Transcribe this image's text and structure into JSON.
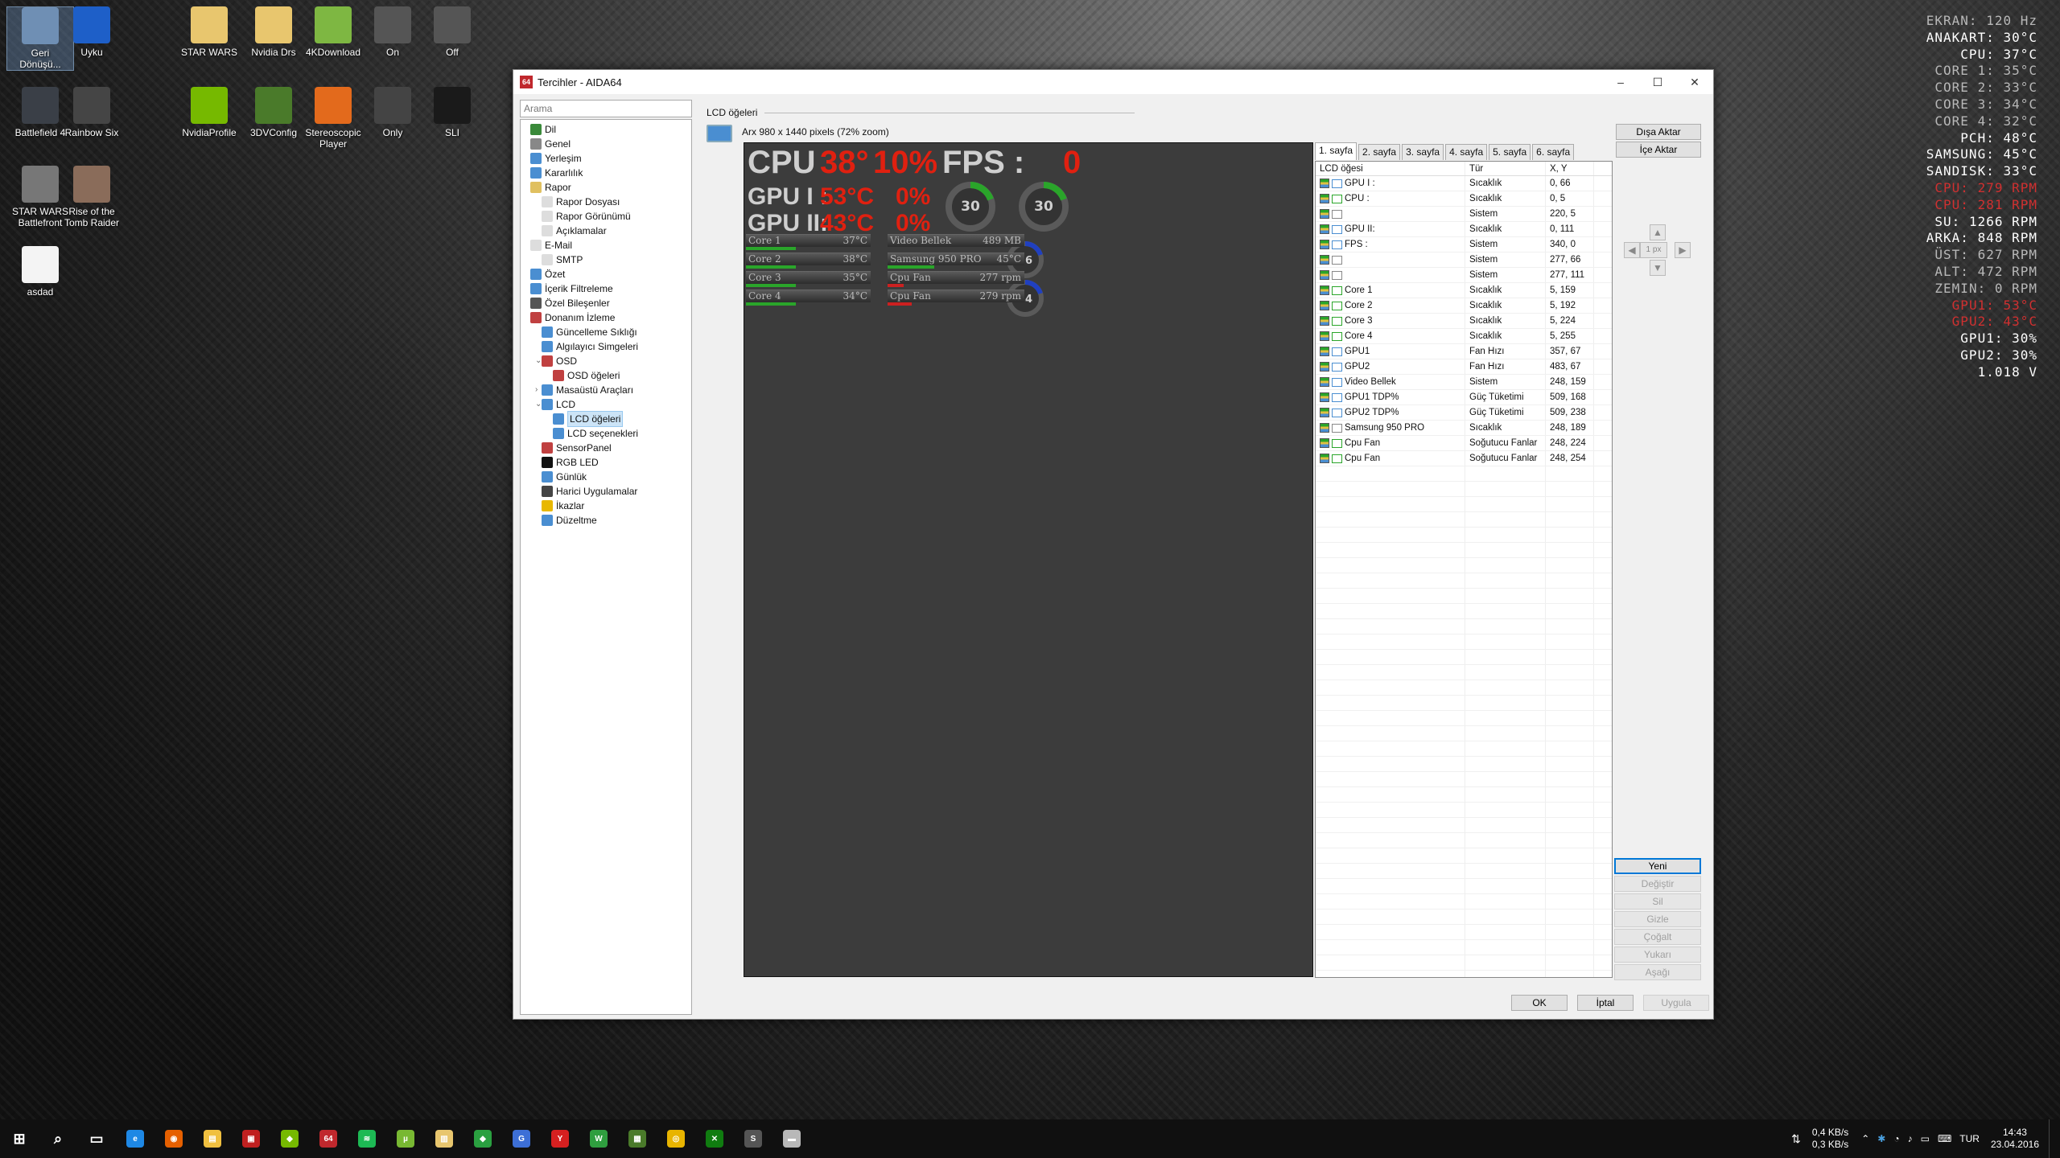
{
  "desktop": {
    "icons": [
      {
        "label": "Geri\nDönüşü...",
        "name": "recycle-bin-icon",
        "color": "#6f8fb4"
      },
      {
        "label": "Uyku",
        "name": "windows-sleep-icon",
        "color": "#1e5fc8"
      },
      {
        "label": "STAR WARS",
        "name": "folder-icon",
        "color": "#e8c66e"
      },
      {
        "label": "Nvidia Drs",
        "name": "folder-icon",
        "color": "#e8c66e"
      },
      {
        "label": "4KDownload",
        "name": "download-icon",
        "color": "#7eb742"
      },
      {
        "label": "On",
        "name": "3d-glasses-icon",
        "color": "#555"
      },
      {
        "label": "Off",
        "name": "3d-glasses-icon",
        "color": "#555"
      },
      {
        "label": "Battlefield 4",
        "name": "game-icon",
        "color": "#3a3f47"
      },
      {
        "label": "Rainbow Six",
        "name": "game-icon",
        "color": "#454545"
      },
      {
        "label": "NvidiaProfile",
        "name": "nvidia-icon",
        "color": "#76b900"
      },
      {
        "label": "3DVConfig",
        "name": "3dv-config-icon",
        "color": "#4a7a2a"
      },
      {
        "label": "Stereoscopic\nPlayer",
        "name": "stereo-player-icon",
        "color": "#e36a1c"
      },
      {
        "label": "Only",
        "name": "sli-icon",
        "color": "#444"
      },
      {
        "label": "SLI",
        "name": "3d-nvidia-icon",
        "color": "#1a1a1a"
      },
      {
        "label": "STAR WARS\nBattlefront",
        "name": "game-icon",
        "color": "#777"
      },
      {
        "label": "Rise of the\nTomb Raider",
        "name": "game-icon",
        "color": "#8a6c5a"
      },
      {
        "label": "asdad",
        "name": "file-icon",
        "color": "#f4f4f4"
      }
    ]
  },
  "osd": [
    {
      "text": "EKRAN: 120 Hz",
      "color": "#b8b8b8"
    },
    {
      "text": "ANAKART: 30°C",
      "color": "#ffffff"
    },
    {
      "text": "CPU: 37°C",
      "color": "#ffffff"
    },
    {
      "text": "CORE 1: 35°C",
      "color": "#b8b8b8"
    },
    {
      "text": "CORE 2: 33°C",
      "color": "#b8b8b8"
    },
    {
      "text": "CORE 3: 34°C",
      "color": "#b8b8b8"
    },
    {
      "text": "CORE 4: 32°C",
      "color": "#b8b8b8"
    },
    {
      "text": "PCH: 48°C",
      "color": "#ffffff"
    },
    {
      "text": "SAMSUNG: 45°C",
      "color": "#ffffff"
    },
    {
      "text": "SANDISK: 33°C",
      "color": "#ffffff"
    },
    {
      "text": "CPU: 279 RPM",
      "color": "#d03030"
    },
    {
      "text": "CPU: 281 RPM",
      "color": "#d03030"
    },
    {
      "text": "SU: 1266 RPM",
      "color": "#ffffff"
    },
    {
      "text": "ARKA: 848 RPM",
      "color": "#ffffff"
    },
    {
      "text": "ÜST: 627 RPM",
      "color": "#b8b8b8"
    },
    {
      "text": "ALT: 472 RPM",
      "color": "#b8b8b8"
    },
    {
      "text": "ZEMIN: 0 RPM",
      "color": "#b8b8b8"
    },
    {
      "text": "GPU1: 53°C",
      "color": "#d03030"
    },
    {
      "text": "GPU2: 43°C",
      "color": "#d03030"
    },
    {
      "text": "GPU1: 30%",
      "color": "#ffffff"
    },
    {
      "text": "GPU2: 30%",
      "color": "#ffffff"
    },
    {
      "text": "1.018 V",
      "color": "#ffffff"
    }
  ],
  "window": {
    "title": "Tercihler - AIDA64",
    "app_badge": "64",
    "buttons": {
      "minimize": "–",
      "maximize": "☐",
      "close": "✕"
    }
  },
  "search": {
    "placeholder": "Arama"
  },
  "tree": [
    {
      "label": "Dil",
      "depth": 0,
      "color": "#3a8a3a"
    },
    {
      "label": "Genel",
      "depth": 0,
      "color": "#888"
    },
    {
      "label": "Yerleşim",
      "depth": 0,
      "color": "#4a8ed1"
    },
    {
      "label": "Kararlılık",
      "depth": 0,
      "color": "#4a8ed1"
    },
    {
      "label": "Rapor",
      "depth": 0,
      "color": "#e0c060"
    },
    {
      "label": "Rapor Dosyası",
      "depth": 1,
      "color": "#ddd"
    },
    {
      "label": "Rapor Görünümü",
      "depth": 1,
      "color": "#ddd"
    },
    {
      "label": "Açıklamalar",
      "depth": 1,
      "color": "#ddd"
    },
    {
      "label": "E-Mail",
      "depth": 0,
      "color": "#ddd"
    },
    {
      "label": "SMTP",
      "depth": 1,
      "color": "#ddd"
    },
    {
      "label": "Özet",
      "depth": 0,
      "color": "#4a8ed1"
    },
    {
      "label": "İçerik Filtreleme",
      "depth": 0,
      "color": "#4a8ed1"
    },
    {
      "label": "Özel Bileşenler",
      "depth": 0,
      "color": "#555"
    },
    {
      "label": "Donanım İzleme",
      "depth": 0,
      "color": "#c04040"
    },
    {
      "label": "Güncelleme Sıklığı",
      "depth": 1,
      "color": "#4a8ed1"
    },
    {
      "label": "Algılayıcı Simgeleri",
      "depth": 1,
      "color": "#4a8ed1"
    },
    {
      "label": "OSD",
      "depth": 1,
      "color": "#c04040",
      "expander": "⌄"
    },
    {
      "label": "OSD öğeleri",
      "depth": 2,
      "color": "#c04040"
    },
    {
      "label": "Masaüstü Araçları",
      "depth": 1,
      "color": "#4a8ed1",
      "expander": "›"
    },
    {
      "label": "LCD",
      "depth": 1,
      "color": "#4a8ed1",
      "expander": "⌄"
    },
    {
      "label": "LCD öğeleri",
      "depth": 2,
      "color": "#4a8ed1",
      "selected": true
    },
    {
      "label": "LCD seçenekleri",
      "depth": 2,
      "color": "#4a8ed1"
    },
    {
      "label": "SensorPanel",
      "depth": 1,
      "color": "#c04040"
    },
    {
      "label": "RGB LED",
      "depth": 1,
      "color": "#111"
    },
    {
      "label": "Günlük",
      "depth": 1,
      "color": "#4a8ed1"
    },
    {
      "label": "Harici Uygulamalar",
      "depth": 1,
      "color": "#444"
    },
    {
      "label": "İkazlar",
      "depth": 1,
      "color": "#e8b800"
    },
    {
      "label": "Düzeltme",
      "depth": 1,
      "color": "#4a8ed1"
    }
  ],
  "panel": {
    "header": "LCD öğeleri",
    "resolution": "Arx 980 x 1440 pixels (72% zoom)"
  },
  "lcd": {
    "cpu_label": "CPU",
    "cpu_temp": "38°",
    "cpu_load": "10%",
    "fps_label": "FPS :",
    "fps_value": "0",
    "gpu1_label": "GPU I :",
    "gpu1_temp": "53°C",
    "gpu1_load": "0%",
    "gpu2_label": "GPU II:",
    "gpu2_temp": "43°C",
    "gpu2_load": "0%",
    "gauge_gpu1": "30",
    "gauge_gpu2": "30",
    "gauge_fan1": "26",
    "gauge_fan2": "24",
    "bars_left": [
      {
        "label": "Core 1",
        "value": "37°C"
      },
      {
        "label": "Core 2",
        "value": "38°C"
      },
      {
        "label": "Core 3",
        "value": "35°C"
      },
      {
        "label": "Core 4",
        "value": "34°C"
      }
    ],
    "bars_right": [
      {
        "label": "Video Bellek",
        "value": "489 MB",
        "color": "#2aa52a"
      },
      {
        "label": "Samsung 950 PRO",
        "value": "45°C",
        "color": "#2aa52a"
      },
      {
        "label": "Cpu Fan",
        "value": "277 rpm",
        "color": "#cc2020"
      },
      {
        "label": "Cpu Fan",
        "value": "279 rpm",
        "color": "#cc2020"
      }
    ]
  },
  "tabs": [
    "1. sayfa",
    "2. sayfa",
    "3. sayfa",
    "4. sayfa",
    "5. sayfa",
    "6. sayfa"
  ],
  "list": {
    "headers": [
      "LCD öğesi",
      "Tür",
      "X, Y"
    ],
    "rows": [
      {
        "name": "GPU I :",
        "type": "Sıcaklık",
        "xy": "0, 66",
        "icon": "monitor"
      },
      {
        "name": "CPU :",
        "type": "Sıcaklık",
        "xy": "0, 5",
        "icon": "chip"
      },
      {
        "name": "",
        "type": "Sistem",
        "xy": "220, 5",
        "icon": "hourglass"
      },
      {
        "name": "GPU II:",
        "type": "Sıcaklık",
        "xy": "0, 111",
        "icon": "monitor"
      },
      {
        "name": "FPS :",
        "type": "Sistem",
        "xy": "340, 0",
        "icon": "monitor"
      },
      {
        "name": "",
        "type": "Sistem",
        "xy": "277, 66",
        "icon": "hourglass"
      },
      {
        "name": "",
        "type": "Sistem",
        "xy": "277, 111",
        "icon": "hourglass"
      },
      {
        "name": "Core 1",
        "type": "Sıcaklık",
        "xy": "5, 159",
        "icon": "chip"
      },
      {
        "name": "Core 2",
        "type": "Sıcaklık",
        "xy": "5, 192",
        "icon": "chip"
      },
      {
        "name": "Core 3",
        "type": "Sıcaklık",
        "xy": "5, 224",
        "icon": "chip"
      },
      {
        "name": "Core 4",
        "type": "Sıcaklık",
        "xy": "5, 255",
        "icon": "chip"
      },
      {
        "name": "GPU1",
        "type": "Fan Hızı",
        "xy": "357, 67",
        "icon": "monitor"
      },
      {
        "name": "GPU2",
        "type": "Fan Hızı",
        "xy": "483, 67",
        "icon": "monitor"
      },
      {
        "name": "Video Bellek",
        "type": "Sistem",
        "xy": "248, 159",
        "icon": "memory"
      },
      {
        "name": "GPU1 TDP%",
        "type": "Güç Tüketimi",
        "xy": "509, 168",
        "icon": "monitor"
      },
      {
        "name": "GPU2 TDP%",
        "type": "Güç Tüketimi",
        "xy": "509, 238",
        "icon": "monitor"
      },
      {
        "name": "Samsung 950 PRO",
        "type": "Sıcaklık",
        "xy": "248, 189",
        "icon": "disk"
      },
      {
        "name": "Cpu Fan",
        "type": "Soğutucu Fanlar",
        "xy": "248, 224",
        "icon": "chip"
      },
      {
        "name": "Cpu Fan",
        "type": "Soğutucu Fanlar",
        "xy": "248, 254",
        "icon": "chip"
      }
    ]
  },
  "side": {
    "export": "Dışa Aktar",
    "import": "İçe Aktar",
    "step": "1 px",
    "new": "Yeni",
    "modify": "Değiştir",
    "delete": "Sil",
    "hide": "Gizle",
    "duplicate": "Çoğalt",
    "up": "Yukarı",
    "down": "Aşağı"
  },
  "footer": {
    "ok": "OK",
    "cancel": "İptal",
    "apply": "Uygula"
  },
  "taskbar": {
    "items": [
      {
        "name": "start-icon",
        "color": "#ffffff",
        "glyph": "⊞"
      },
      {
        "name": "search-icon",
        "color": "#ffffff",
        "glyph": "⌕"
      },
      {
        "name": "task-view-icon",
        "color": "#ffffff",
        "glyph": "▭"
      },
      {
        "name": "edge-icon",
        "color": "#1e88e5",
        "glyph": "e"
      },
      {
        "name": "firefox-icon",
        "color": "#e66000",
        "glyph": "◉"
      },
      {
        "name": "file-explorer-icon",
        "color": "#f0c040",
        "glyph": "▤"
      },
      {
        "name": "app-icon",
        "color": "#c02020",
        "glyph": "▣"
      },
      {
        "name": "nvidia-icon",
        "color": "#76b900",
        "glyph": "◆"
      },
      {
        "name": "aida64-icon",
        "color": "#c0282d",
        "glyph": "64"
      },
      {
        "name": "spotify-icon",
        "color": "#1db954",
        "glyph": "≋"
      },
      {
        "name": "utorrent-icon",
        "color": "#78b832",
        "glyph": "µ"
      },
      {
        "name": "folder-icon",
        "color": "#e8c66e",
        "glyph": "▥"
      },
      {
        "name": "app-icon",
        "color": "#2aa040",
        "glyph": "◆"
      },
      {
        "name": "app-icon",
        "color": "#3d6fd6",
        "glyph": "G"
      },
      {
        "name": "yandex-icon",
        "color": "#d62020",
        "glyph": "Y"
      },
      {
        "name": "app-icon",
        "color": "#2f9e3f",
        "glyph": "W"
      },
      {
        "name": "app-icon",
        "color": "#4a7a2a",
        "glyph": "▦"
      },
      {
        "name": "chrome-icon",
        "color": "#e8b400",
        "glyph": "◎"
      },
      {
        "name": "xbox-icon",
        "color": "#107c10",
        "glyph": "✕"
      },
      {
        "name": "steam-icon",
        "color": "#555555",
        "glyph": "S"
      },
      {
        "name": "app-icon",
        "color": "#b8b8b8",
        "glyph": "▬"
      }
    ],
    "net_down": "0,4 KB/s",
    "net_up": "0,3 KB/s",
    "lang": "TUR",
    "time": "14:43",
    "date": "23.04.2016"
  }
}
